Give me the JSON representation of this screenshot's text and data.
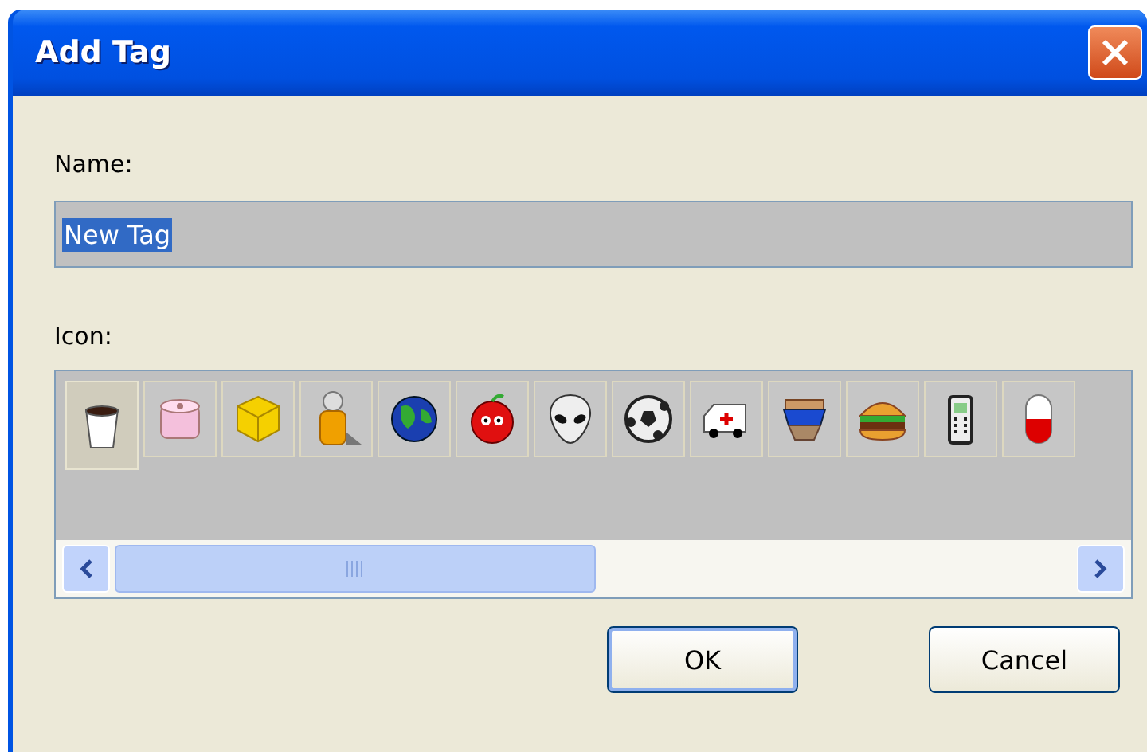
{
  "window": {
    "title": "Add Tag"
  },
  "name_field": {
    "label": "Name:",
    "value": "New Tag",
    "text_selected": true
  },
  "icon_picker": {
    "label": "Icon:",
    "icons": [
      {
        "selected": true
      },
      {
        "selected": false
      },
      {
        "selected": false
      },
      {
        "selected": false
      },
      {
        "selected": false
      },
      {
        "selected": false
      },
      {
        "selected": false
      },
      {
        "selected": false
      },
      {
        "selected": false
      },
      {
        "selected": false
      },
      {
        "selected": false
      },
      {
        "selected": false
      },
      {
        "selected": false
      }
    ]
  },
  "buttons": [
    {
      "label": "OK",
      "default": true
    },
    {
      "label": "Cancel",
      "default": false
    }
  ]
}
